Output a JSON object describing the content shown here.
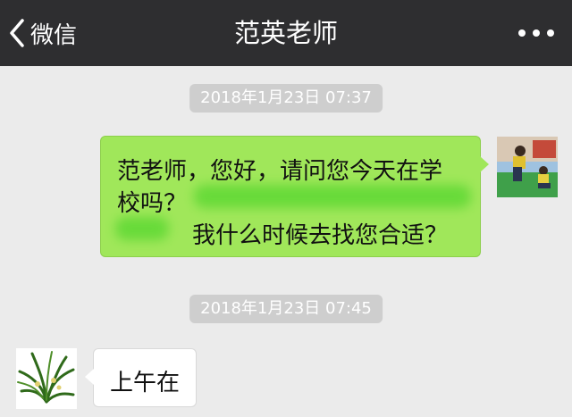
{
  "header": {
    "back_label": "微信",
    "title": "范英老师"
  },
  "messages": [
    {
      "timestamp": "2018年1月23日 07:37",
      "direction": "outgoing",
      "line1": "范老师，您好，请问您今天在学",
      "line2": "校吗？",
      "line3": "我什么时候去找您合适？"
    },
    {
      "timestamp": "2018年1月23日 07:45",
      "direction": "incoming",
      "text": "上午在"
    }
  ],
  "colors": {
    "header_bg": "#2e2e30",
    "chat_bg": "#ebebeb",
    "outgoing_bubble": "#a0e75a",
    "incoming_bubble": "#ffffff",
    "timestamp_bg": "#cecece"
  },
  "icons": {
    "back": "chevron-left-icon",
    "more": "more-dots-icon"
  }
}
